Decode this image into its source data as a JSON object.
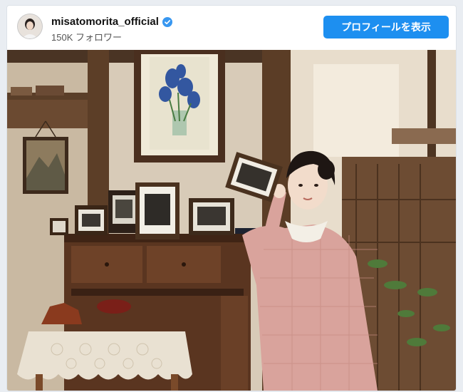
{
  "post": {
    "username": "misatomorita_official",
    "followers": "150K フォロワー",
    "follow_button": "プロフィールを表示",
    "verified": true
  },
  "colors": {
    "accent": "#1d8ff0",
    "verified_badge": "#3897f0"
  },
  "icons": {
    "avatar": "avatar-photo",
    "badge": "verified-badge-icon"
  }
}
